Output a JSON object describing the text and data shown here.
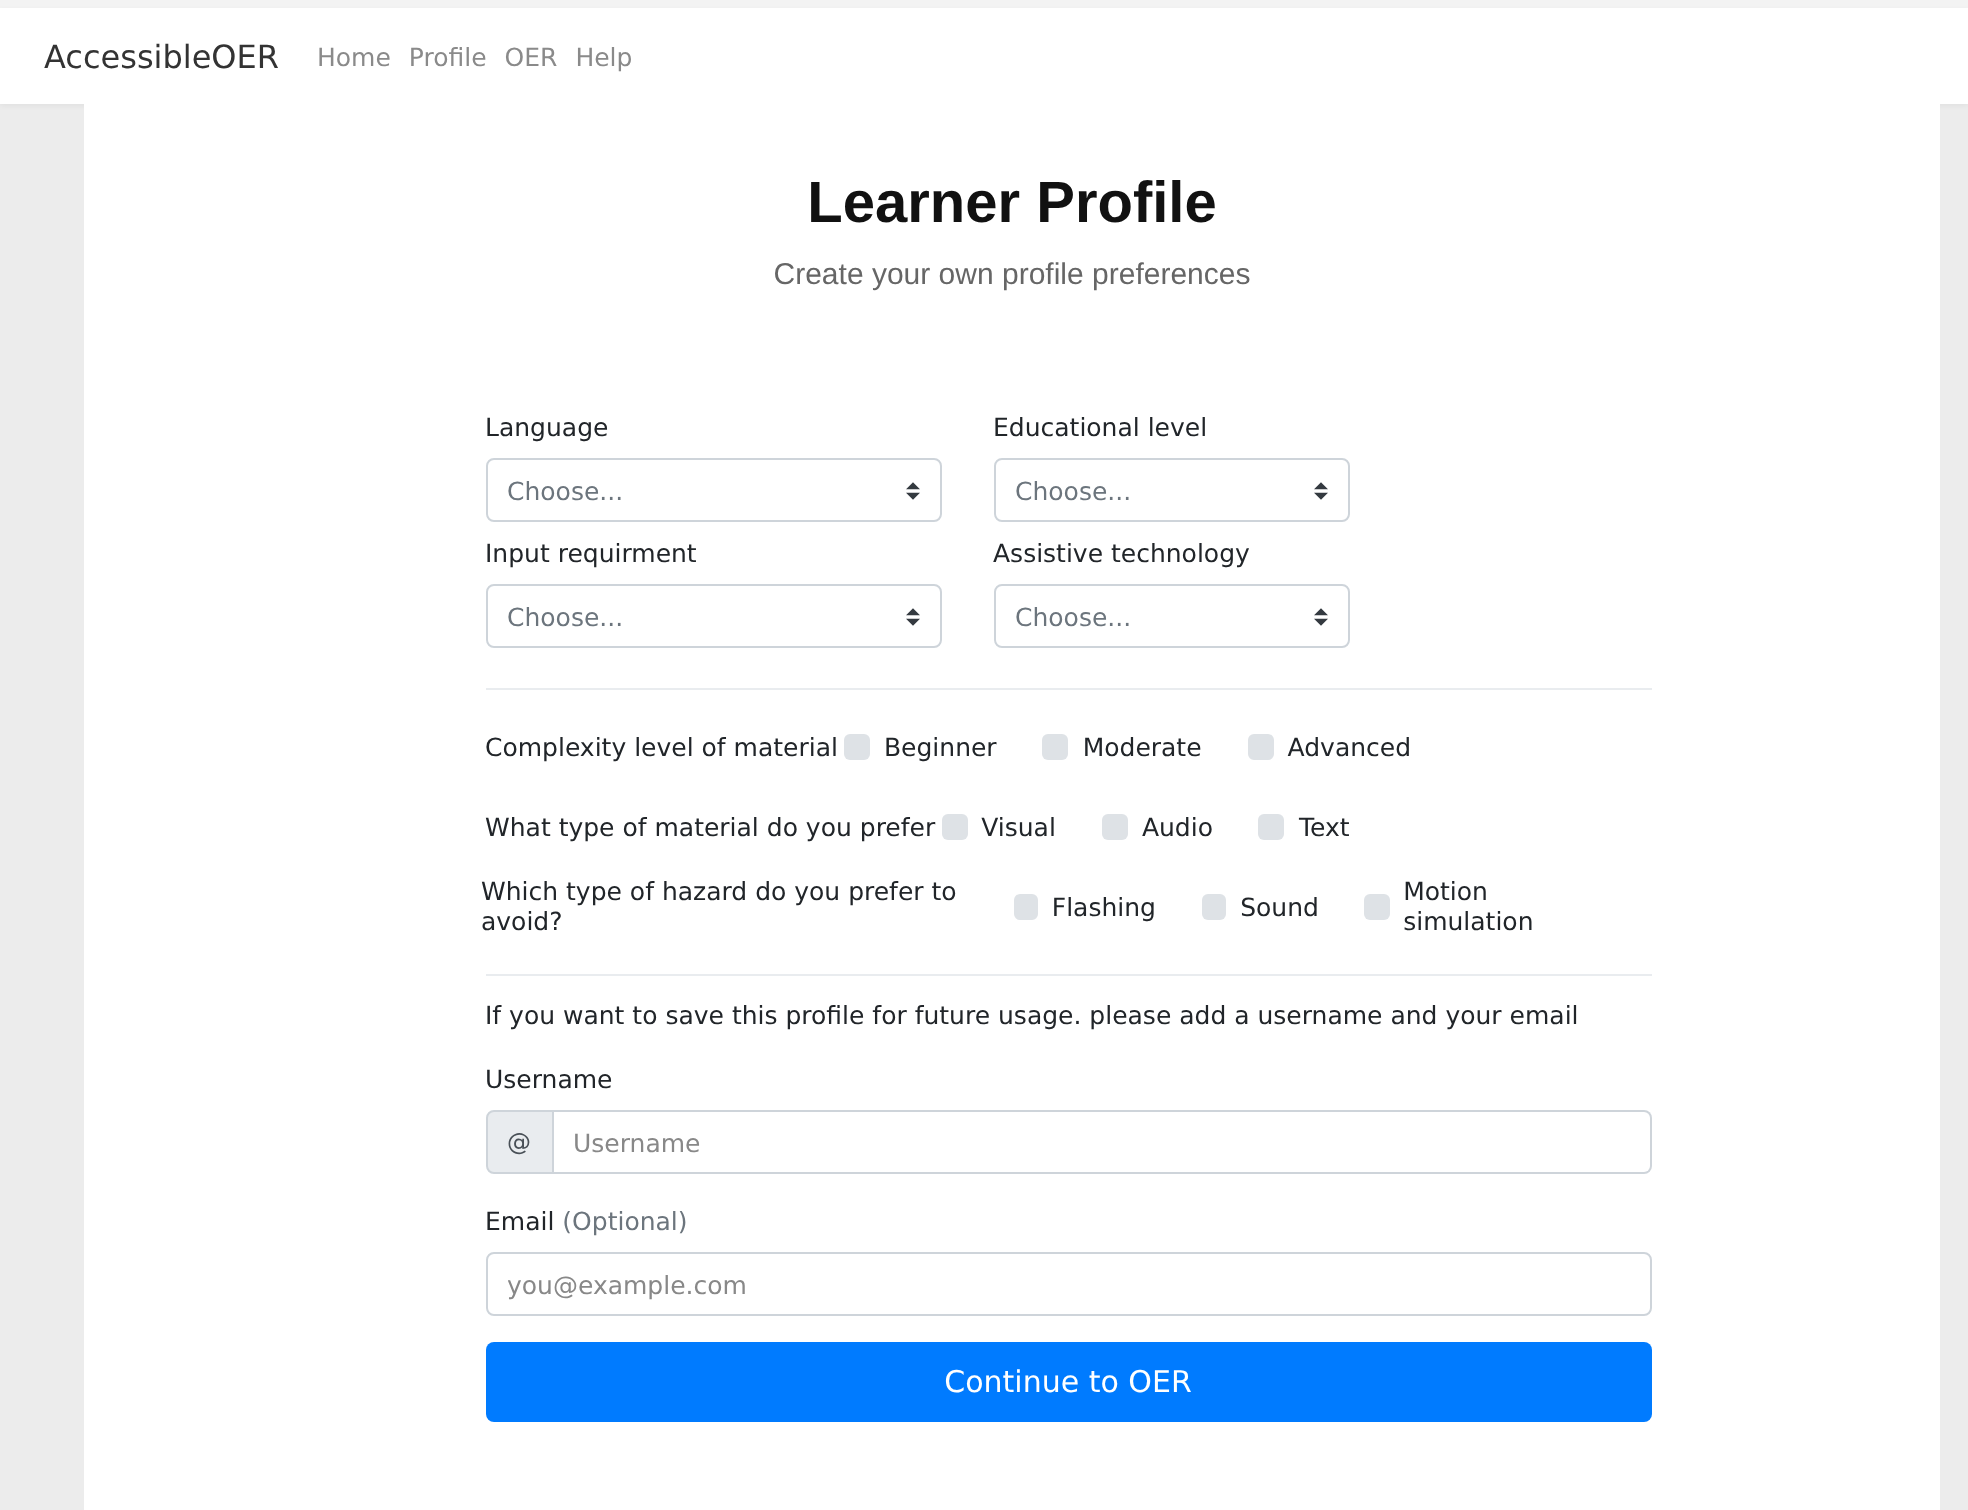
{
  "navbar": {
    "brand": "AccessibleOER",
    "links": [
      {
        "label": "Home"
      },
      {
        "label": "Profile"
      },
      {
        "label": "OER"
      },
      {
        "label": "Help"
      }
    ]
  },
  "header": {
    "title": "Learner Profile",
    "subtitle": "Create your own profile preferences"
  },
  "selects": [
    {
      "label": "Language",
      "value": "Choose..."
    },
    {
      "label": "Educational level",
      "value": "Choose..."
    },
    {
      "label": "Input requirment",
      "value": "Choose..."
    },
    {
      "label": "Assistive technology",
      "value": "Choose..."
    }
  ],
  "checkbox_groups": [
    {
      "label": "Complexity level of material",
      "options": [
        {
          "label": "Beginner",
          "checked": false
        },
        {
          "label": "Moderate",
          "checked": false
        },
        {
          "label": "Advanced",
          "checked": false
        }
      ]
    },
    {
      "label": "What type of material do you prefer",
      "options": [
        {
          "label": "Visual",
          "checked": false
        },
        {
          "label": "Audio",
          "checked": false
        },
        {
          "label": "Text",
          "checked": false
        }
      ]
    },
    {
      "label": "Which type of hazard do you prefer to avoid?",
      "options": [
        {
          "label": "Flashing",
          "checked": false
        },
        {
          "label": "Sound",
          "checked": false
        },
        {
          "label": "Motion simulation",
          "checked": false
        }
      ]
    }
  ],
  "save_note": "If you want to save this profile for future usage. please add a username and your email",
  "username": {
    "label": "Username",
    "prefix": "@",
    "placeholder": "Username"
  },
  "email": {
    "label": "Email",
    "hint": "(Optional)",
    "placeholder": "you@example.com"
  },
  "submit": {
    "label": "Continue to OER"
  }
}
